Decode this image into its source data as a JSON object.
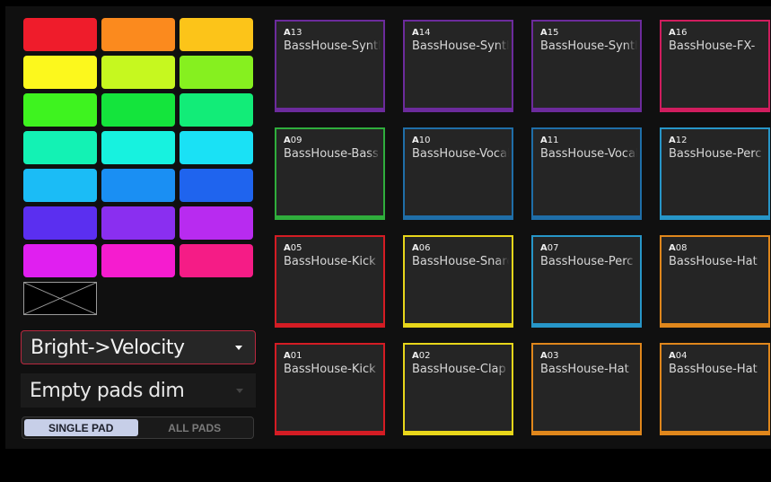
{
  "colors": {
    "accent_border": "#b9283f",
    "toggle_active_bg": "#c7cfe8",
    "pad_bg": "#252525"
  },
  "swatches": [
    [
      "#ef1c2b",
      "#fb8a1e",
      "#fcc419"
    ],
    [
      "#fcf81d",
      "#c6f81f",
      "#86f01f"
    ],
    [
      "#3ef31f",
      "#14e43c",
      "#12ec78"
    ],
    [
      "#13f2b4",
      "#17f2df",
      "#1ae1f5"
    ],
    [
      "#1bbcf6",
      "#1a8ff3",
      "#1f64ee"
    ],
    [
      "#5b2ff0",
      "#8a2ff0",
      "#b82bf0"
    ],
    [
      "#e01ff0",
      "#f51ccf",
      "#f51c86"
    ]
  ],
  "empty_swatch_icon": "no-color-x-icon",
  "dropdowns": {
    "mode_label": "Bright->Velocity",
    "empty_label": "Empty pads dim"
  },
  "toggle": {
    "single_label": "SINGLE PAD",
    "all_label": "ALL PADS",
    "selected": "single"
  },
  "pads": [
    {
      "bank": "A",
      "num": "13",
      "name": "BassHouse-Synth",
      "color": "#6c2b9c"
    },
    {
      "bank": "A",
      "num": "14",
      "name": "BassHouse-Synth",
      "color": "#6c2b9c"
    },
    {
      "bank": "A",
      "num": "15",
      "name": "BassHouse-Synth",
      "color": "#6c2b9c"
    },
    {
      "bank": "A",
      "num": "16",
      "name": "BassHouse-FX-",
      "color": "#d01d5e"
    },
    {
      "bank": "A",
      "num": "09",
      "name": "BassHouse-Bass",
      "color": "#2fae3c"
    },
    {
      "bank": "A",
      "num": "10",
      "name": "BassHouse-Vocal",
      "color": "#1f6ea8"
    },
    {
      "bank": "A",
      "num": "11",
      "name": "BassHouse-Vocal",
      "color": "#1f6ea8"
    },
    {
      "bank": "A",
      "num": "12",
      "name": "BassHouse-Perc",
      "color": "#2796c8"
    },
    {
      "bank": "A",
      "num": "05",
      "name": "BassHouse-Kick",
      "color": "#d41c24"
    },
    {
      "bank": "A",
      "num": "06",
      "name": "BassHouse-Snare",
      "color": "#e8d61a"
    },
    {
      "bank": "A",
      "num": "07",
      "name": "BassHouse-Perc",
      "color": "#2796c8"
    },
    {
      "bank": "A",
      "num": "08",
      "name": "BassHouse-Hat",
      "color": "#e0871c"
    },
    {
      "bank": "A",
      "num": "01",
      "name": "BassHouse-Kick",
      "color": "#d41c24"
    },
    {
      "bank": "A",
      "num": "02",
      "name": "BassHouse-Clap",
      "color": "#e8d61a"
    },
    {
      "bank": "A",
      "num": "03",
      "name": "BassHouse-Hat",
      "color": "#e0871c"
    },
    {
      "bank": "A",
      "num": "04",
      "name": "BassHouse-Hat",
      "color": "#e0871c"
    }
  ]
}
